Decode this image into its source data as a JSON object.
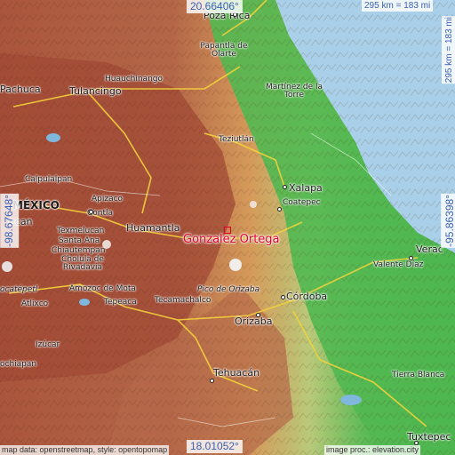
{
  "map": {
    "focus_place": "Gonzalez Ortega",
    "coords": {
      "top": "20.66406°",
      "bottom": "18.01052°",
      "left": "-98.67648°",
      "right": "-95.86398°"
    },
    "scale": {
      "top": "295 km = 183 mi",
      "right": "295 km = 183 mi"
    },
    "credits": {
      "left": "map data: openstreetmap, style: opentopomap",
      "right": "image proc.: elevation.city"
    },
    "places": {
      "poza_rica": "Poza Rica",
      "papantla": "Papantla de Olarte",
      "pachuca": "Pachuca",
      "tulancingo": "Tulancingo",
      "huauchinango": "Huauchinango",
      "martinez": "Martínez de la Torre",
      "teziutlan": "Teziutlán",
      "xalapa": "Xalapa",
      "coatepec": "Coatepec",
      "calpulalpan": "Calpulalpan",
      "mexico": "MÉXICO",
      "apizaco": "Apizaco",
      "contla": "Contla",
      "huamantla": "Huamantla",
      "ecatepec_cut": "ecan",
      "texmelucan": "Texmelucan",
      "santa_ana": "Santa Ana",
      "chiautempan": "Chiautempan",
      "cholula": "Cholula de Rivadavia",
      "popocatepetl": "ocatépetl",
      "atlixco": "Atlixco",
      "amozoc": "Amozoc de Mota",
      "tepeaca": "Tepeaca",
      "tecamachalco": "Tecamachalco",
      "pico": "Pico de Orizaba",
      "cordoba": "Córdoba",
      "orizaba": "Orizaba",
      "veracruz_cut": "Verac",
      "valente": "Valente Díaz",
      "izucar": "Izúcar",
      "tehuacan": "Tehuacán",
      "tierra_blanca": "Tierra Blanca",
      "chiapan_cut": "ochiapan",
      "tuxtepec": "Tuxtepec"
    },
    "colors": {
      "sea": "#a9d0e8",
      "lowland": "#3fae4a",
      "highland": "#b05a3c",
      "focus": "#e0002a",
      "coord_text": "#3a5fb0"
    }
  }
}
